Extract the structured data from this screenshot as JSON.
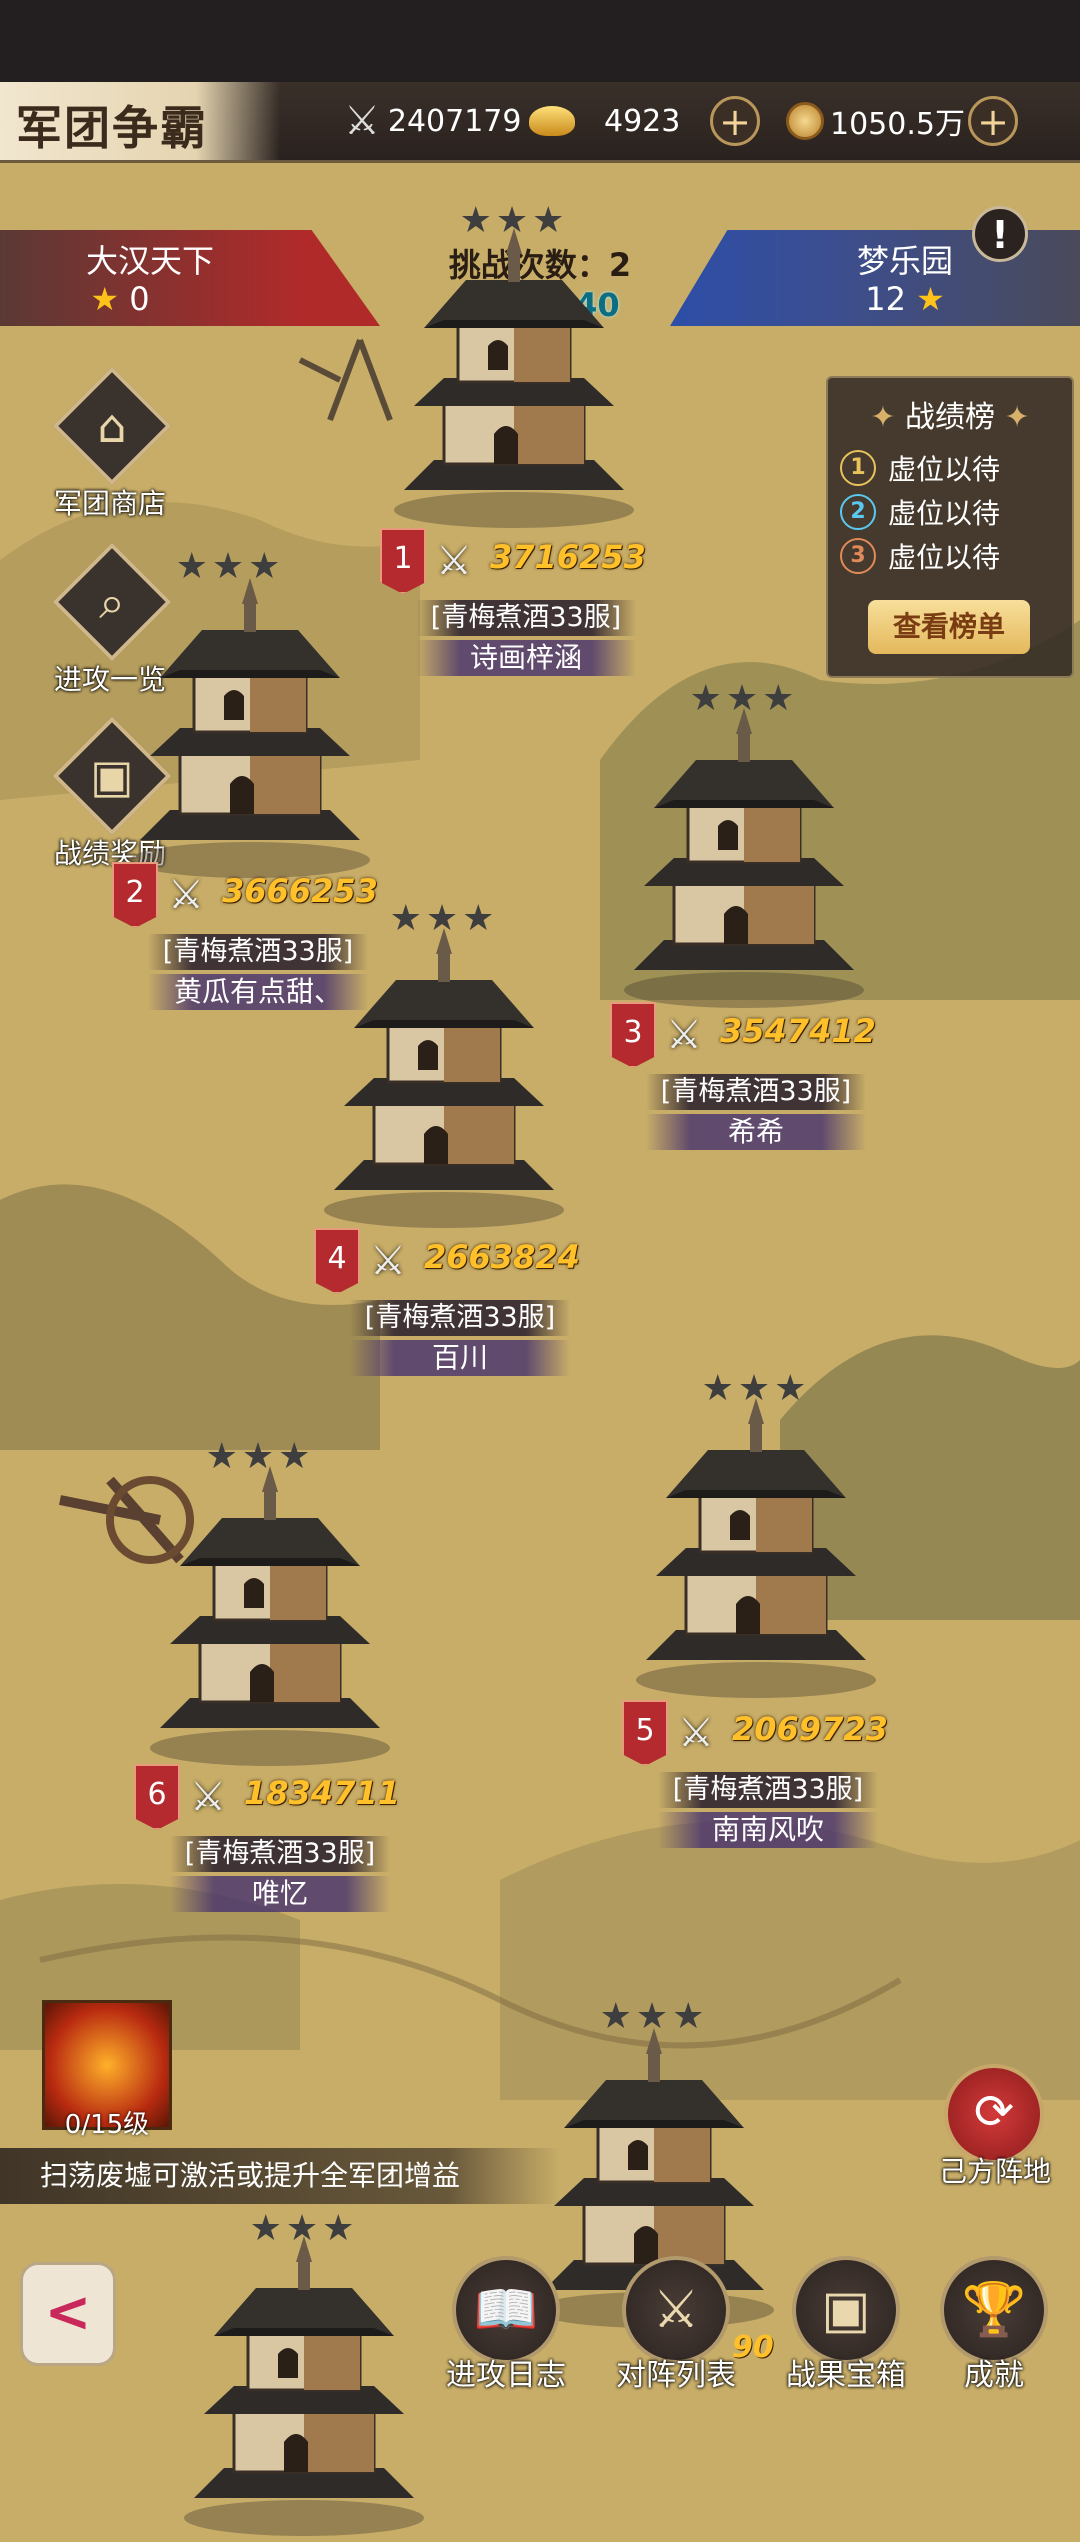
{
  "header": {
    "title": "军团争霸",
    "combat_power": "2407179",
    "ingots": "4923",
    "copper": "1050.5万"
  },
  "match": {
    "left_team": {
      "name": "大汉天下",
      "stars": "0"
    },
    "right_team": {
      "name": "梦乐园",
      "stars": "12"
    },
    "challenge_label": "挑战次数：2",
    "timer": "07:00:40"
  },
  "side_menu": [
    {
      "label": "军团商店",
      "icon": "shop-icon"
    },
    {
      "label": "进攻一览",
      "icon": "magnifier-icon"
    },
    {
      "label": "战绩奖励",
      "icon": "chest-icon"
    }
  ],
  "leaderboard": {
    "title": "战绩榜",
    "entries": [
      "虚位以待",
      "虚位以待",
      "虚位以待"
    ],
    "ranks": [
      "1",
      "2",
      "3"
    ],
    "button": "查看榜单"
  },
  "towers": [
    {
      "rank": "1",
      "power": "3716253",
      "server": "[青梅煮酒33服]",
      "player": "诗画梓涵",
      "stars": "★★★"
    },
    {
      "rank": "2",
      "power": "3666253",
      "server": "[青梅煮酒33服]",
      "player": "黄瓜有点甜、",
      "stars": "★★★"
    },
    {
      "rank": "3",
      "power": "3547412",
      "server": "[青梅煮酒33服]",
      "player": "希希",
      "stars": "★★★"
    },
    {
      "rank": "4",
      "power": "2663824",
      "server": "[青梅煮酒33服]",
      "player": "百川",
      "stars": "★★★"
    },
    {
      "rank": "5",
      "power": "2069723",
      "server": "[青梅煮酒33服]",
      "player": "南南风吹",
      "stars": "★★★"
    },
    {
      "rank": "6",
      "power": "1834711",
      "server": "[青梅煮酒33服]",
      "player": "唯忆",
      "stars": "★★★"
    },
    {
      "stars": "★★★"
    },
    {
      "stars": "★★★"
    }
  ],
  "buff": {
    "level": "0/15级",
    "tip": "扫荡废墟可激活或提升全军团增益"
  },
  "own_base": {
    "label": "己方阵地"
  },
  "bottom_nav": [
    {
      "label": "进攻日志",
      "icon": "book-icon"
    },
    {
      "label": "对阵列表",
      "icon": "crossed-swords-icon"
    },
    {
      "label": "战果宝箱",
      "icon": "treasure-chest-icon"
    },
    {
      "label": "成就",
      "icon": "trophy-icon"
    }
  ],
  "partial_power": "90",
  "colors": {
    "accent_gold": "#ffc02a",
    "timer": "#0d6e83",
    "left_team": "#b12a2a",
    "right_team": "#2d4ea8"
  }
}
